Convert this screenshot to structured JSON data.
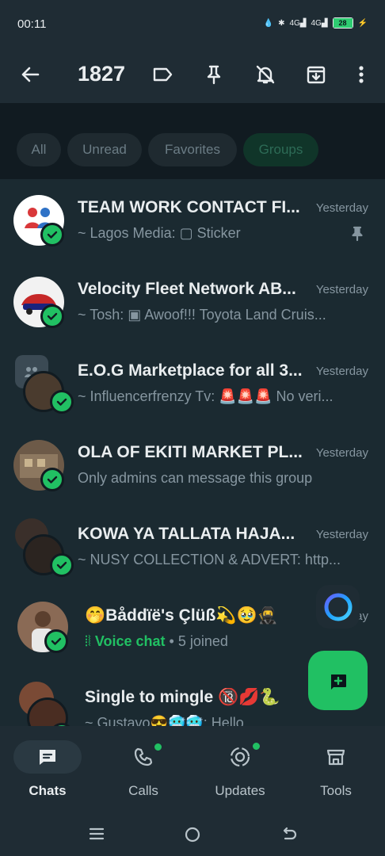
{
  "status_bar": {
    "time": "00:11",
    "network_1": "4G",
    "network_2": "4G",
    "battery": "28"
  },
  "header": {
    "selected_count": "1827"
  },
  "filters": [
    {
      "label": "All"
    },
    {
      "label": "Unread"
    },
    {
      "label": "Favorites"
    },
    {
      "label": "Groups",
      "active": true
    }
  ],
  "chats": [
    {
      "name": "TEAM WORK  CONTACT FI...",
      "time": "Yesterday",
      "preview": "~ Lagos Media: ▢ Sticker",
      "pinned": true
    },
    {
      "name": "Velocity Fleet Network AB...",
      "time": "Yesterday",
      "preview": "~ Tosh: ▣ Awoof!!! Toyota Land Cruis..."
    },
    {
      "name": "E.O.G Marketplace for all 3...",
      "time": "Yesterday",
      "preview": "~ Influencerfrenzy Tv: 🚨🚨🚨 No veri..."
    },
    {
      "name": "OLA OF EKITI MARKET PL...",
      "time": "Yesterday",
      "preview": "Only admins can message this group"
    },
    {
      "name": "KOWA YA TALLATA HAJA...",
      "time": "Yesterday",
      "preview": "~ NUSY COLLECTION & ADVERT: http..."
    },
    {
      "name": "🤭Båddïë's Çlüß💫🥹🥷",
      "time": "Yesterday",
      "voice_chat_label": "Voice chat",
      "voice_chat_suffix": " • 5 joined"
    },
    {
      "name": "Single to mingle 🔞💋🐍",
      "time": "",
      "preview": "~ Gustavo😎🥶🥶: Hello"
    }
  ],
  "bottom_nav": [
    {
      "label": "Chats",
      "active": true
    },
    {
      "label": "Calls"
    },
    {
      "label": "Updates"
    },
    {
      "label": "Tools"
    }
  ],
  "colors": {
    "accent": "#21c063",
    "background": "#111b21",
    "bar": "#1f2c34"
  },
  "icons": {
    "header": [
      "back-arrow-icon",
      "label-icon",
      "pin-icon",
      "mute-icon",
      "archive-icon",
      "more-icon"
    ],
    "nav": [
      "chats-icon",
      "calls-icon",
      "updates-icon",
      "tools-icon"
    ],
    "fab": "new-chat-icon",
    "ai": "meta-ai-icon"
  }
}
